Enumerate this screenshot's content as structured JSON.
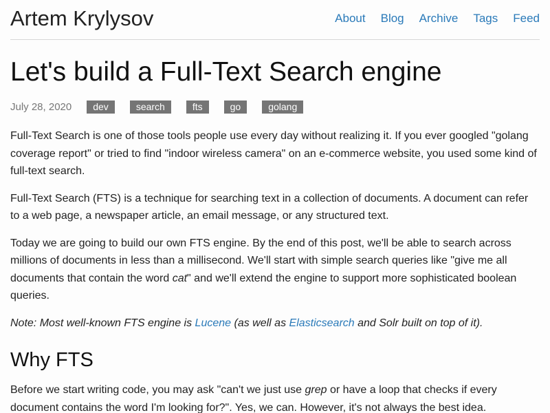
{
  "header": {
    "site_title": "Artem Krylysov",
    "nav": [
      "About",
      "Blog",
      "Archive",
      "Tags",
      "Feed"
    ]
  },
  "post": {
    "title": "Let's build a Full-Text Search engine",
    "date": "July 28, 2020",
    "tags": [
      "dev",
      "search",
      "fts",
      "go",
      "golang"
    ]
  },
  "body": {
    "p1": "Full-Text Search is one of those tools people use every day without realizing it. If you ever googled \"golang coverage report\" or tried to find \"indoor wireless camera\" on an e-commerce website, you used some kind of full-text search.",
    "p2": "Full-Text Search (FTS) is a technique for searching text in a collection of documents. A document can refer to a web page, a newspaper article, an email message, or any structured text.",
    "p3_a": "Today we are going to build our own FTS engine. By the end of this post, we'll be able to search across millions of documents in less than a millisecond. We'll start with simple search queries like \"give me all documents that contain the word ",
    "p3_em": "cat",
    "p3_b": "\" and we'll extend the engine to support more sophisticated boolean queries.",
    "note_a": "Note: Most well-known FTS engine is ",
    "note_link1": "Lucene",
    "note_b": " (as well as ",
    "note_link2": "Elasticsearch",
    "note_c": " and Solr built on top of it).",
    "h2": "Why FTS",
    "p5_a": "Before we start writing code, you may ask \"can't we just use ",
    "p5_em": "grep",
    "p5_b": " or have a loop that checks if every document contains the word I'm looking for?\". Yes, we can. However, it's not always the best idea."
  },
  "colors": {
    "link": "#2a7ab9",
    "tag_bg": "#757575",
    "date": "#777777"
  }
}
